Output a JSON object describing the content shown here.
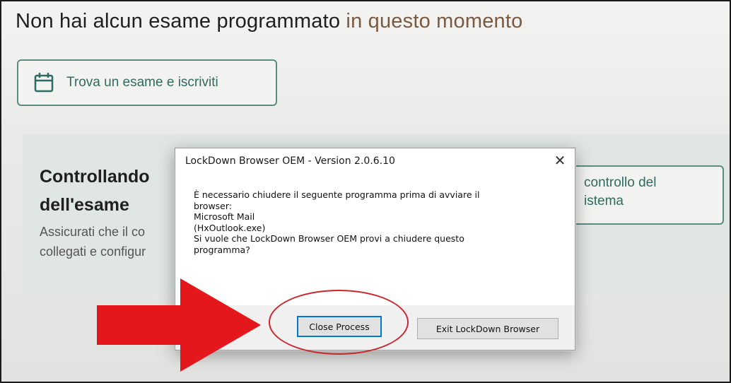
{
  "page": {
    "title_part1": "Non hai alcun esame programmato",
    "title_part2": "in questo momento"
  },
  "find_exam": {
    "icon": "calendar-icon",
    "label": "Trova un esame e iscriviti"
  },
  "system_check": {
    "heading_line1": "Controllando",
    "heading_line2": "dell'esame",
    "desc_line1": "Assicurati che il co",
    "desc_line2": "collegati e configur",
    "button_line1": "controllo del",
    "button_line2": "istema"
  },
  "dialog": {
    "title": "LockDown Browser OEM - Version 2.0.6.10",
    "close_glyph": "✕",
    "message_lines": [
      "È necessario chiudere il seguente programma prima di avviare il",
      "browser:",
      "Microsoft Mail",
      "(HxOutlook.exe)",
      "Si vuole che LockDown Browser OEM provi a chiudere questo",
      "programma?"
    ],
    "primary_button": "Close Process",
    "secondary_button": "Exit LockDown Browser"
  },
  "annotation": {
    "arrow_color": "#e3171c",
    "ellipse_color": "#c7262c"
  }
}
